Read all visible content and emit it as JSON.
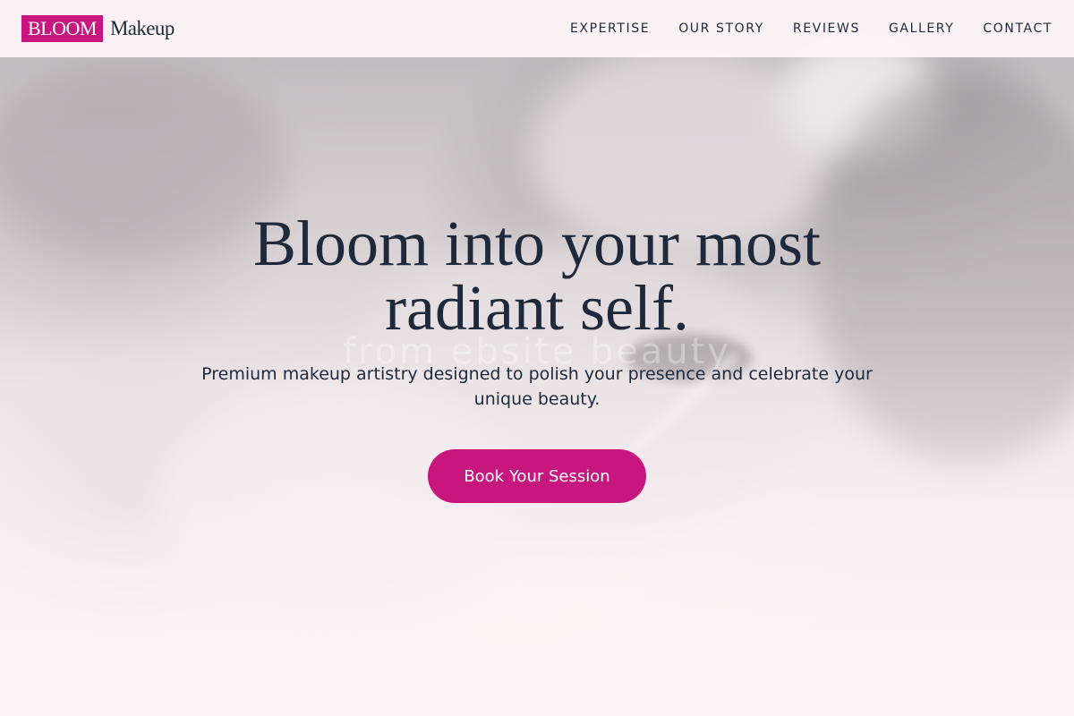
{
  "brand": {
    "badge": "BLOOM",
    "name": "Makeup",
    "accent_color": "#c7177f"
  },
  "nav": {
    "items": [
      {
        "label": "EXPERTISE"
      },
      {
        "label": "OUR STORY"
      },
      {
        "label": "REVIEWS"
      },
      {
        "label": "GALLERY"
      },
      {
        "label": "CONTACT"
      }
    ]
  },
  "hero": {
    "title": "Bloom into your most radiant self.",
    "ghost_text": "from ebsite beauty",
    "subtitle": "Premium makeup artistry designed to polish your presence and celebrate your unique beauty.",
    "cta_label": "Book Your Session"
  },
  "colors": {
    "text": "#1e293b",
    "background": "#fbf2f4",
    "button": "#c7177f"
  }
}
